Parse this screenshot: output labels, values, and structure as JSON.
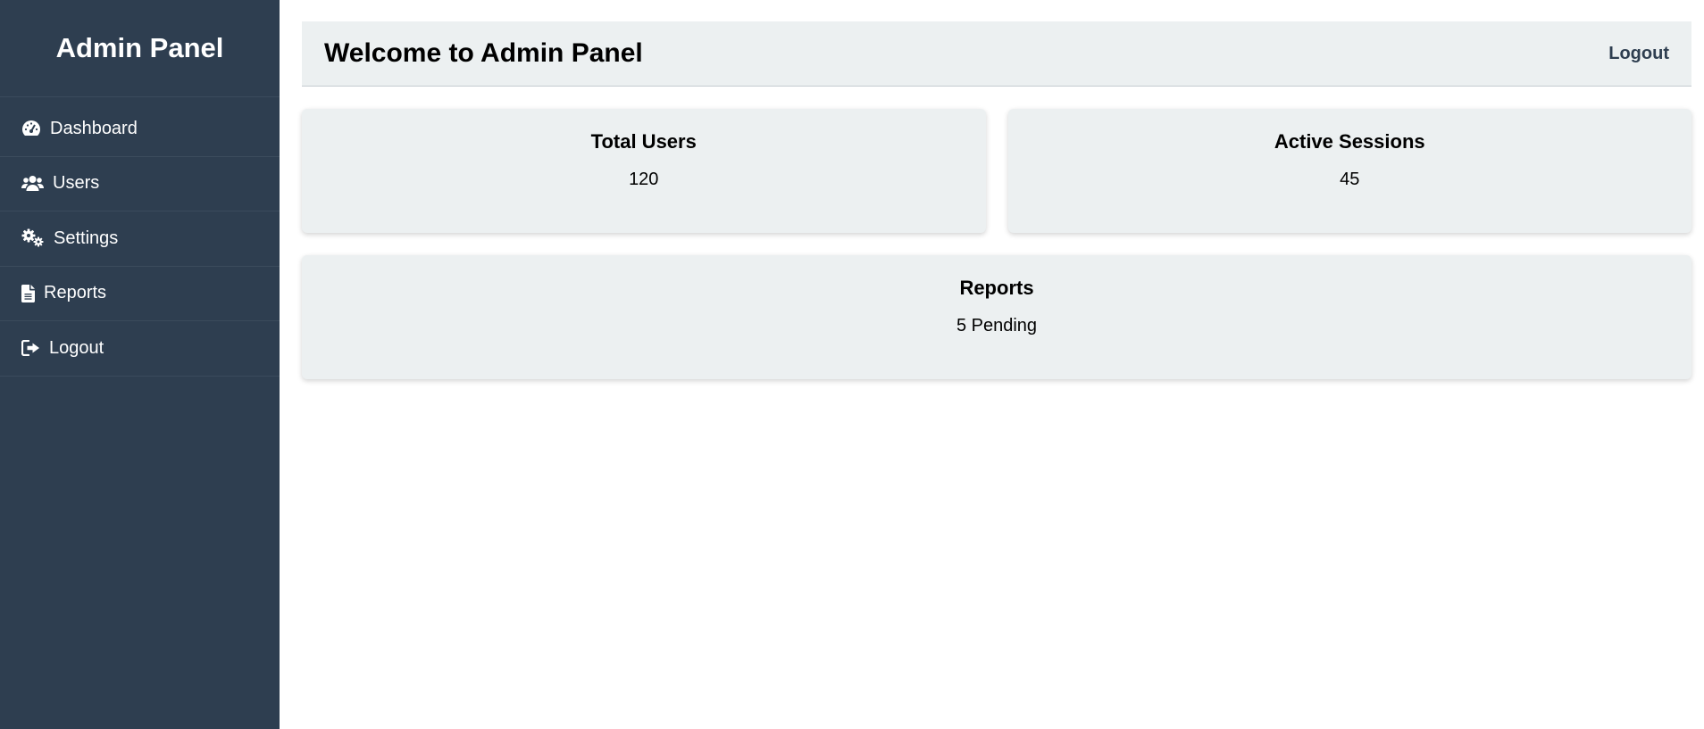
{
  "sidebar": {
    "title": "Admin Panel",
    "items": [
      {
        "label": "Dashboard",
        "icon": "dashboard-icon"
      },
      {
        "label": "Users",
        "icon": "users-icon"
      },
      {
        "label": "Settings",
        "icon": "settings-icon"
      },
      {
        "label": "Reports",
        "icon": "document-icon"
      },
      {
        "label": "Logout",
        "icon": "logout-icon"
      }
    ]
  },
  "header": {
    "title": "Welcome to Admin Panel",
    "logout_label": "Logout"
  },
  "cards": [
    {
      "title": "Total Users",
      "value": "120"
    },
    {
      "title": "Active Sessions",
      "value": "45"
    },
    {
      "title": "Reports",
      "value": "5 Pending"
    }
  ],
  "colors": {
    "sidebar_bg": "#2e3e50",
    "card_bg": "#ecf0f1",
    "accent_text": "#2e3e50"
  }
}
